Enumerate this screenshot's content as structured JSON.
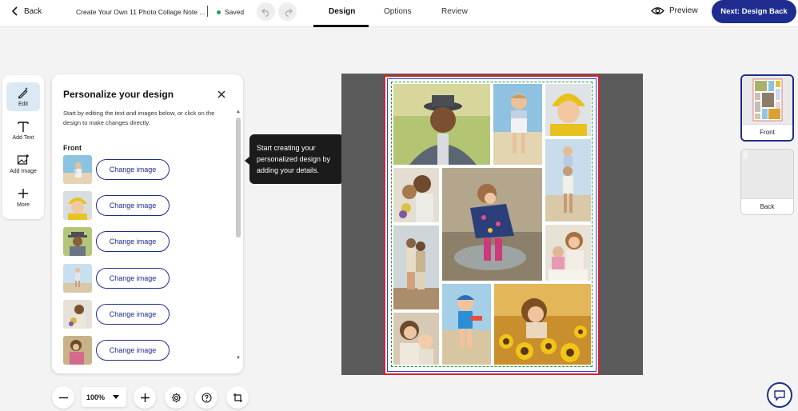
{
  "topbar": {
    "back_label": "Back",
    "doc_title": "Create Your Own 11 Photo Collage Note ...",
    "saved_label": "Saved",
    "tabs": [
      {
        "label": "Design",
        "active": true
      },
      {
        "label": "Options",
        "active": false
      },
      {
        "label": "Review",
        "active": false
      }
    ],
    "preview_label": "Preview",
    "next_label": "Next: Design Back"
  },
  "tools": [
    {
      "label": "Edit",
      "icon": "pen-sparkle-icon",
      "active": true
    },
    {
      "label": "Add Text",
      "icon": "text-t-icon",
      "active": false
    },
    {
      "label": "Add Image",
      "icon": "image-add-icon",
      "active": false
    },
    {
      "label": "More",
      "icon": "plus-icon",
      "active": false
    }
  ],
  "panel": {
    "title": "Personalize your design",
    "description": "Start by editing the text and images below, or click on the design to make changes directly.",
    "section_label": "Front",
    "change_label": "Change image",
    "images": [
      {
        "subject": "child-beach"
      },
      {
        "subject": "baby-yellow-hat"
      },
      {
        "subject": "grandfather-hat"
      },
      {
        "subject": "child-shoulders"
      },
      {
        "subject": "mother-child-flowers"
      },
      {
        "subject": "girl-outdoors"
      }
    ]
  },
  "tooltip": {
    "text": "Start creating your personalized design by adding your details."
  },
  "pages": [
    {
      "label": "Front",
      "active": true
    },
    {
      "label": "Back",
      "active": false
    }
  ],
  "zoom": {
    "value": "100%"
  },
  "colors": {
    "accent": "#1e2d8f",
    "bleed": "#d9202a",
    "trim": "#2a3fbf",
    "safe": "#1c9a3a"
  }
}
